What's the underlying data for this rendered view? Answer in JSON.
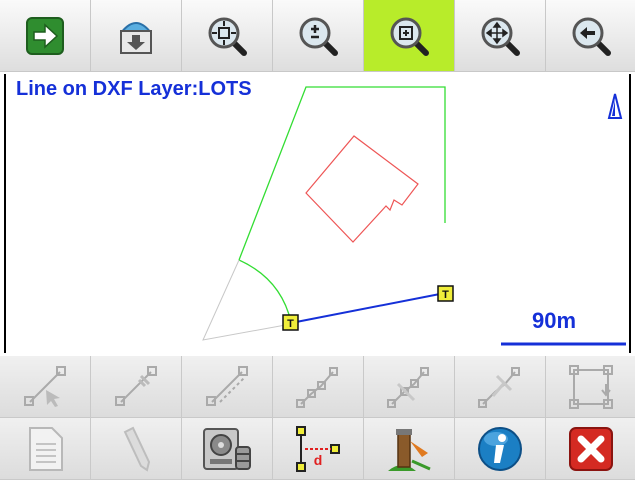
{
  "toolbar": {
    "buttons": [
      {
        "icon": "forward-arrow-icon",
        "active": false
      },
      {
        "icon": "download-map-icon",
        "active": false
      },
      {
        "icon": "zoom-extents-icon",
        "active": false
      },
      {
        "icon": "zoom-in-out-icon",
        "active": false
      },
      {
        "icon": "zoom-window-icon",
        "active": true
      },
      {
        "icon": "pan-icon",
        "active": false
      },
      {
        "icon": "zoom-previous-icon",
        "active": false
      }
    ],
    "active_color": "#b8ec2a"
  },
  "map": {
    "title": "Line on DXF Layer:LOTS",
    "scale_label": "90m",
    "colors": {
      "title": "#1530d8",
      "boundary": "#33dd33",
      "building": "#ee4444",
      "selected_line": "#1530d8",
      "ghost": "#c8c8c8"
    },
    "point_marker_label": "T"
  },
  "bottom_toolbar": {
    "row1": [
      {
        "icon": "select-line-icon",
        "enabled": false
      },
      {
        "icon": "edit-line-icon",
        "enabled": false
      },
      {
        "icon": "offset-line-icon",
        "enabled": false
      },
      {
        "icon": "polyline-icon",
        "enabled": false
      },
      {
        "icon": "split-polyline-icon",
        "enabled": false
      },
      {
        "icon": "join-polyline-icon",
        "enabled": false
      },
      {
        "icon": "area-icon",
        "enabled": false
      }
    ],
    "row2": [
      {
        "icon": "report-icon",
        "enabled": false
      },
      {
        "icon": "pencil-icon",
        "enabled": false
      },
      {
        "icon": "storage-icon",
        "enabled": true
      },
      {
        "icon": "distance-icon",
        "enabled": true
      },
      {
        "icon": "stakeout-icon",
        "enabled": true
      },
      {
        "icon": "info-icon",
        "enabled": true
      },
      {
        "icon": "close-icon",
        "enabled": true
      }
    ]
  }
}
